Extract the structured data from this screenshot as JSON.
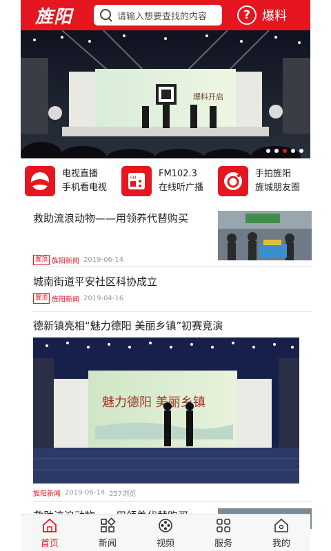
{
  "header": {
    "logo_text": "旌阳",
    "search_placeholder": "请输入想要查找的内容",
    "baoliao_label": "爆料"
  },
  "banner": {
    "slide_count": 5,
    "active_index": 2,
    "screen_text": "爆料开启"
  },
  "quick_links": [
    {
      "title": "电视直播",
      "subtitle": "手机看电视",
      "icon": "tv-icon"
    },
    {
      "title": "FM102.3",
      "subtitle": "在线听广播",
      "icon": "radio-icon"
    },
    {
      "title": "手拍旌阳",
      "subtitle": "旌城朋友圈",
      "icon": "camera-icon"
    }
  ],
  "news": [
    {
      "title": "救助流浪动物——用领养代替购买",
      "tag": "置顶",
      "source": "旌阳新闻",
      "date": "2019-06-14"
    },
    {
      "title": "城南街道平安社区科协成立",
      "tag": "置顶",
      "source": "旌阳新闻",
      "date": "2019-04-16"
    },
    {
      "title": "德新镇亮相“魅力德阳 美丽乡镇”初赛竞演",
      "source": "旌阳新闻",
      "date": "2019-06-14",
      "views": "257浏览",
      "screen_text": "魅力德阳 美丽乡镇"
    },
    {
      "title": "救助流浪动物——用领养代替购买"
    }
  ],
  "tabs": [
    {
      "label": "首页",
      "icon": "home-icon",
      "active": true
    },
    {
      "label": "新闻",
      "icon": "news-icon",
      "active": false
    },
    {
      "label": "视频",
      "icon": "video-icon",
      "active": false
    },
    {
      "label": "服务",
      "icon": "service-icon",
      "active": false
    },
    {
      "label": "我的",
      "icon": "profile-icon",
      "active": false
    }
  ],
  "colors": {
    "brand": "#e5161f"
  }
}
